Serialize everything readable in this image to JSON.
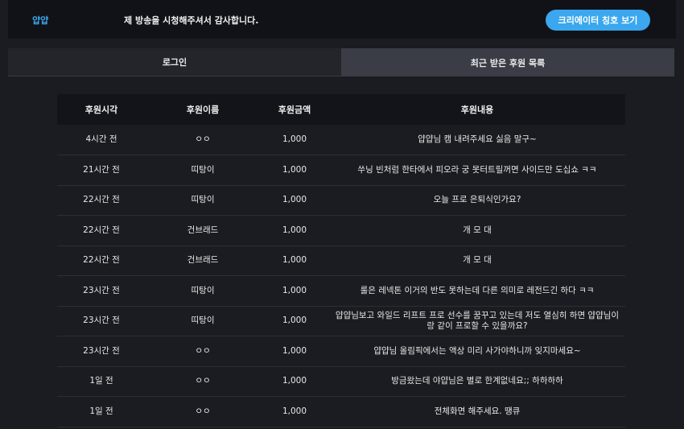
{
  "header": {
    "brand": "얍얍",
    "greeting": "제 방송을 시청해주셔서 감사합니다.",
    "title_button": "크리에이터 칭호 보기"
  },
  "tabs": [
    {
      "label": "로그인",
      "active": false
    },
    {
      "label": "최근 받은 후원 목록",
      "active": true
    }
  ],
  "table": {
    "headers": [
      "후원시각",
      "후원이름",
      "후원금액",
      "후원내용"
    ],
    "rows": [
      [
        "4시간 전",
        "ㅇㅇ",
        "1,000",
        "얍얍님 캠 내려주세요 싫음 말구~"
      ],
      [
        "21시간 전",
        "띠탕이",
        "1,000",
        "쑤닝 빈처럼 한타에서 피오라 궁 못터트릴꺼면 사이드만 도십쇼 ㅋㅋ"
      ],
      [
        "22시간 전",
        "띠탕이",
        "1,000",
        "오늘 프로 은퇴식인가요?"
      ],
      [
        "22시간 전",
        "건브래드",
        "1,000",
        "개 모 대"
      ],
      [
        "22시간 전",
        "건브래드",
        "1,000",
        "개 모 대"
      ],
      [
        "23시간 전",
        "띠탕이",
        "1,000",
        "룰은 레넥톤 이거의 반도 못하는데 다른 의미로 레전드긴 하다 ㅋㅋ"
      ],
      [
        "23시간 전",
        "띠탕이",
        "1,000",
        "얍얍님보고 와일드 리프트 프로 선수를 꿈꾸고 있는데 저도 열심히 하면 얍얍님이랑 같이 프로할 수 있을까요?"
      ],
      [
        "23시간 전",
        "ㅇㅇ",
        "1,000",
        "얍얍님 올림픽에서는 액상 미리 사가야하니까 잊지마세요~"
      ],
      [
        "1일 전",
        "ㅇㅇ",
        "1,000",
        "방금왔는데 야얍님은 별로 한계없네요;; 하하하하"
      ],
      [
        "1일 전",
        "ㅇㅇ",
        "1,000",
        "전체화면 해주세요. 땡큐"
      ]
    ]
  }
}
